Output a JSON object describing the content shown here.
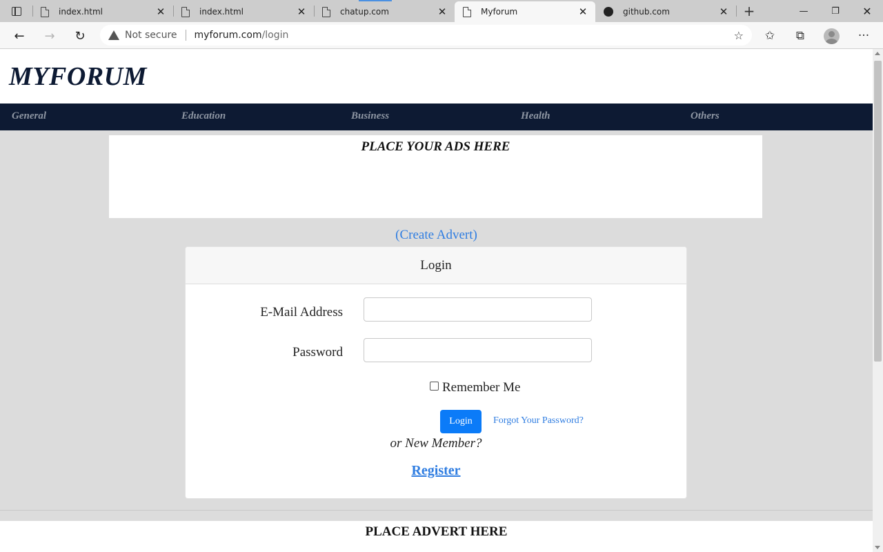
{
  "browser": {
    "tabs": [
      {
        "title": "index.html",
        "icon": "page-icon",
        "active": false
      },
      {
        "title": "index.html",
        "icon": "page-icon",
        "active": false
      },
      {
        "title": "chatup.com",
        "icon": "page-icon",
        "active": false
      },
      {
        "title": "Myforum",
        "icon": "page-icon",
        "active": true
      },
      {
        "title": "github.com",
        "icon": "github-icon",
        "active": false
      }
    ],
    "close_glyph": "✕",
    "address": {
      "security_label": "Not secure",
      "host": "myforum.com",
      "path": "/login"
    }
  },
  "site": {
    "logo": "MYFORUM",
    "nav": [
      "General",
      "Education",
      "Business",
      "Health",
      "Others"
    ],
    "top_ad": "PLACE YOUR ADS HERE",
    "create_advert": "(Create Advert)",
    "footer_ad": "PLACE ADVERT HERE"
  },
  "login_form": {
    "title": "Login",
    "email_label": "E-Mail Address",
    "email_value": "",
    "password_label": "Password",
    "password_value": "",
    "remember_label": "Remember Me",
    "remember_checked": false,
    "login_button": "Login",
    "forgot_link": "Forgot Your Password?",
    "new_member": "or New Member?",
    "register_link": "Register"
  },
  "colors": {
    "navbar_bg": "#0d1a33",
    "link": "#2f7de1",
    "primary_button": "#0b7bf8",
    "page_bg": "#dcdcdc"
  }
}
